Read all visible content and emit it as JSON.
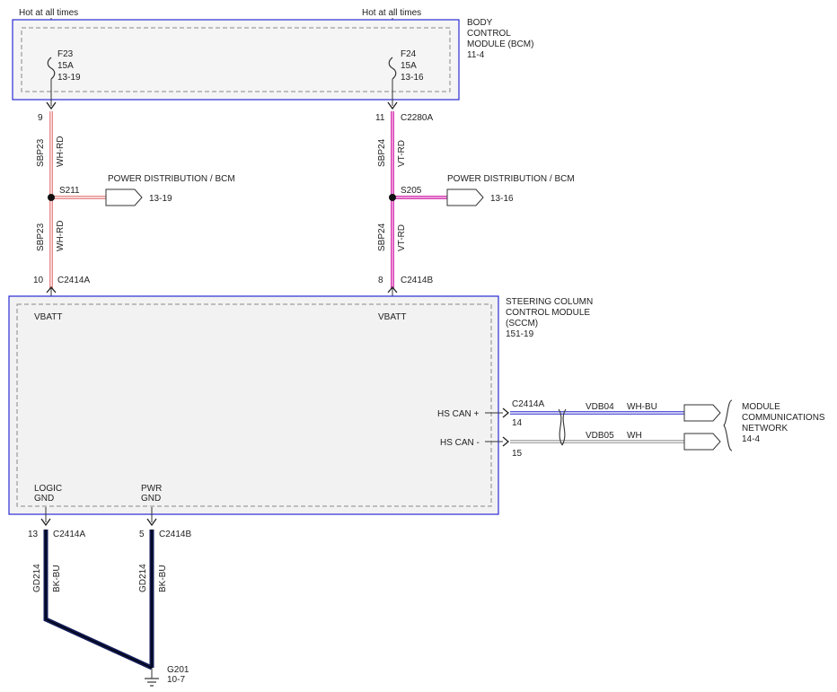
{
  "feed": {
    "left": "Hot at all times",
    "right": "Hot at all times"
  },
  "bcm": {
    "title": [
      "BODY",
      "CONTROL",
      "MODULE (BCM)",
      "11-4"
    ]
  },
  "fuses": [
    {
      "name": "F23",
      "rating": "15A",
      "ref": "13-19"
    },
    {
      "name": "F24",
      "rating": "15A",
      "ref": "13-16"
    }
  ],
  "circuit_left": {
    "pin_top": "9",
    "circuit": "SBP23",
    "color": "WH-RD",
    "splice": "S211",
    "dest": "POWER DISTRIBUTION / BCM",
    "dest_ref": "13-19",
    "pin_bottom": "10",
    "conn_bottom": "C2414A"
  },
  "circuit_right": {
    "pin_top": "11",
    "conn_top": "C2280A",
    "circuit": "SBP24",
    "color": "VT-RD",
    "splice": "S205",
    "dest": "POWER DISTRIBUTION / BCM",
    "dest_ref": "13-16",
    "pin_bottom": "8",
    "conn_bottom": "C2414B"
  },
  "sccm": {
    "title": [
      "STEERING COLUMN",
      "CONTROL MODULE",
      "(SCCM)",
      "151-19"
    ],
    "vbatt_left": "VBATT",
    "vbatt_right": "VBATT",
    "hs_can_plus": "HS CAN +",
    "hs_can_minus": "HS CAN -",
    "logic_gnd": [
      "LOGIC",
      "GND"
    ],
    "pwr_gnd": [
      "PWR",
      "GND"
    ]
  },
  "can": {
    "connector": "C2414A",
    "pin_plus": "14",
    "pin_minus": "15",
    "circuit_plus": "VDB04",
    "color_plus": "WH-BU",
    "circuit_minus": "VDB05",
    "color_minus": "WH",
    "dest": [
      "MODULE",
      "COMMUNICATIONS",
      "NETWORK",
      "14-4"
    ]
  },
  "ground": {
    "left_pin": "13",
    "left_conn": "C2414A",
    "right_pin": "5",
    "right_conn": "C2414B",
    "circuit": "GD214",
    "color": "BK-BU",
    "point": "G201",
    "point_ref": "10-7"
  },
  "colors": {
    "module_border": "#2b2bd6",
    "module_fill": "#f2f2f2",
    "wire_wh_rd": "#e88a8a",
    "wire_vt_rd": "#d63fb5",
    "wire_bk_bu": "#101a55",
    "wire_wh_bu": "#5b5bd8",
    "wire_wh": "#aaaaaa"
  }
}
